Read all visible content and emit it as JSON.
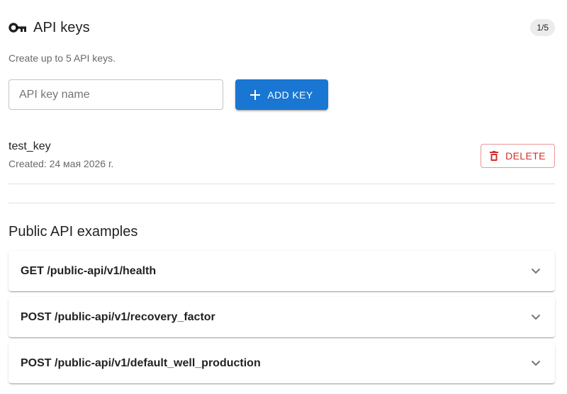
{
  "header": {
    "title": "API keys",
    "count_badge": "1/5",
    "icon": "key-icon"
  },
  "subtitle": "Create up to 5 API keys.",
  "new_key": {
    "placeholder": "API key name",
    "value": "",
    "add_label": "ADD KEY"
  },
  "keys": [
    {
      "name": "test_key",
      "created": "Created: 24 мая 2026 г.",
      "delete_label": "DELETE"
    }
  ],
  "examples": {
    "title": "Public API examples",
    "items": [
      {
        "label": "GET /public-api/v1/health"
      },
      {
        "label": "POST /public-api/v1/recovery_factor"
      },
      {
        "label": "POST /public-api/v1/default_well_production"
      }
    ]
  },
  "colors": {
    "primary": "#1976d2",
    "error": "#d32f2f",
    "badge_bg": "#ececec"
  }
}
